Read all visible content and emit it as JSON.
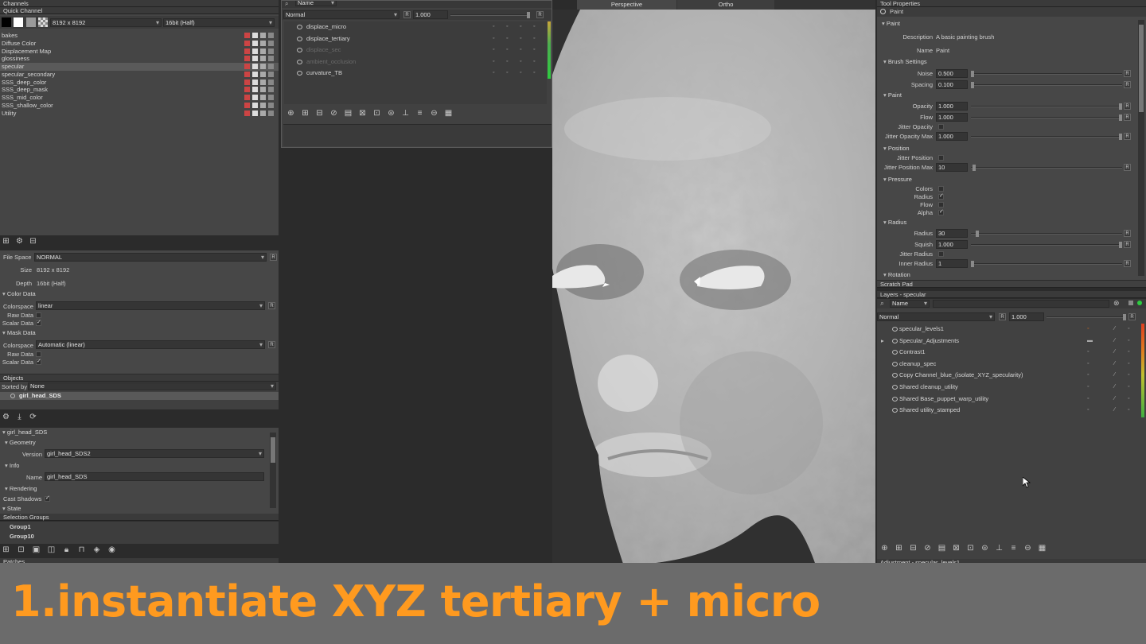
{
  "caption": {
    "text": "1.instantiate XYZ tertiary + micro",
    "color": "#ff9a1f"
  },
  "channels": {
    "title": "Channels",
    "quick": "Quick Channel",
    "size": "8192 x 8192",
    "depth": "16bit (Half)",
    "items": [
      "bakes",
      "Diffuse Color",
      "Displacement Map",
      "glossiness",
      "specular",
      "specular_secondary",
      "SSS_deep_color",
      "SSS_deep_mask",
      "SSS_mid_color",
      "SSS_shallow_color",
      "Utility"
    ],
    "selected": 4
  },
  "props": {
    "file_space_label": "File Space",
    "file_space": "NORMAL",
    "size_label": "Size",
    "size": "8192 x 8192",
    "depth_label": "Depth",
    "depth": "16bit (Half)",
    "color_data": "Color Data",
    "colorspace_label": "Colorspace",
    "colorspace": "linear",
    "raw_label": "Raw Data",
    "scalar_label": "Scalar Data",
    "mask_data": "Mask Data",
    "mask_colorspace": "Automatic (linear)"
  },
  "objects": {
    "title": "Objects",
    "sorted_label": "Sorted by",
    "sorted": "None",
    "item": "girl_head_SDS"
  },
  "object_props": {
    "title": "girl_head_SDS",
    "geometry": "Geometry",
    "version_label": "Version",
    "version": "girl_head_SDS2",
    "info": "Info",
    "name_label": "Name",
    "name": "girl_head_SDS",
    "rendering": "Rendering",
    "cast_shadows": "Cast Shadows",
    "state": "State"
  },
  "selection": {
    "title": "Selection Groups",
    "items": [
      "Group1",
      "Group10"
    ]
  },
  "patches": {
    "title": "Patches"
  },
  "midlayers": {
    "name_label": "Name",
    "blend": "Normal",
    "opacity": "1.000",
    "items": [
      {
        "name": "displace_micro",
        "dim": false
      },
      {
        "name": "displace_tertiary",
        "dim": false
      },
      {
        "name": "displace_sec",
        "dim": true
      },
      {
        "name": "ambient_occlusion",
        "dim": true
      },
      {
        "name": "curvature_TB",
        "dim": false
      }
    ]
  },
  "viewport": {
    "tabs": [
      "Perspective",
      "Ortho"
    ]
  },
  "tool": {
    "title": "Tool Properties",
    "tool": "Paint",
    "section": "Paint",
    "desc_label": "Description",
    "desc": "A basic painting brush",
    "name_label": "Name",
    "name": "Paint",
    "brush": "Brush Settings",
    "noise_label": "Noise",
    "noise": "0.500",
    "spacing_label": "Spacing",
    "spacing": "0.100",
    "paint": "Paint",
    "opacity_label": "Opacity",
    "opacity": "1.000",
    "flow_label": "Flow",
    "flow": "1.000",
    "jit_op_label": "Jitter Opacity",
    "jit_op_max_label": "Jitter Opacity Max",
    "jit_op_max": "1.000",
    "position": "Position",
    "jit_pos_label": "Jitter Position",
    "jit_pos_max_label": "Jitter Position Max",
    "jit_pos_max": "10",
    "pressure": "Pressure",
    "colors_label": "Colors",
    "radius_label": "Radius",
    "flow2_label": "Flow",
    "alpha_label": "Alpha",
    "radius_sec": "Radius",
    "radius_val_label": "Radius",
    "radius_val": "30",
    "squish_label": "Squish",
    "squish": "1.000",
    "jit_rad_label": "Jitter Radius",
    "inner_label": "Inner Radius",
    "inner": "1",
    "rotation": "Rotation",
    "scratch": "Scratch Pad"
  },
  "layers": {
    "title": "Layers - specular",
    "name_label": "Name",
    "blend": "Normal",
    "opacity": "1.000",
    "items": [
      "specular_levels1",
      "Specular_Adjustments",
      "Contrast1",
      "cleanup_spec",
      "Copy Channel_blue_(isolate_XYZ_specularity)",
      "Shared cleanup_utility",
      "Shared Base_puppet_warp_utility",
      "Shared utility_stamped"
    ],
    "bottom": "Adjustment - specular_levels1"
  }
}
